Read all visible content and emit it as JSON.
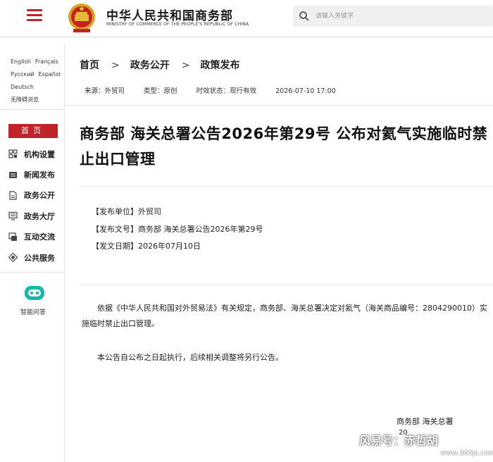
{
  "header": {
    "site_title_cn": "中华人民共和国商务部",
    "site_title_en": "MINISTRY OF COMMERCE OF THE PEOPLE'S REPUBLIC OF CHINA",
    "search_placeholder": "请输入关键字",
    "accent_color": "#c0242a"
  },
  "sidebar": {
    "languages": [
      "English",
      "Français",
      "Русский",
      "Español",
      "Deutsch"
    ],
    "accessible_label": "无障碍浏览",
    "home_label": "首页",
    "nav": [
      {
        "label": "机构设置",
        "icon": "org-grid-icon"
      },
      {
        "label": "新闻发布",
        "icon": "news-icon"
      },
      {
        "label": "政务公开",
        "icon": "document-icon"
      },
      {
        "label": "政务大厅",
        "icon": "monitor-icon"
      },
      {
        "label": "互动交流",
        "icon": "chat-icon"
      },
      {
        "label": "公共服务",
        "icon": "service-diamond-icon"
      }
    ],
    "assistant_label": "智能问答"
  },
  "breadcrumb": {
    "home": "首页",
    "sep1": ">",
    "level1": "政务公开",
    "sep2": ">",
    "level2": "政策发布"
  },
  "meta": {
    "source": "来源：外贸司",
    "type": "类型：原创",
    "status": "时效状态：现行有效",
    "datetime": "2026-07-10 17:00"
  },
  "article": {
    "title": "商务部 海关总署公告2026年第29号 公布对氦气实施临时禁止出口管理",
    "publisher": "【发布单位】外贸司",
    "doc_number": "【发布文号】商务部 海关总署公告2026年第29号",
    "issue_date": "【发文日期】2026年07月10日",
    "paragraph1": "依据《中华人民共和国对外贸易法》有关规定，商务部、海关总署决定对氦气（海关商品编号：2804290010）实施临时禁止出口管理。",
    "paragraph2": "本公告自公布之日起执行，后续相关调整将另行公告。",
    "signature": "商务部 海关总署",
    "date_fragment": "20"
  },
  "watermark": {
    "text": "风易号：赤哲胡",
    "url": "www.365jz.com"
  }
}
